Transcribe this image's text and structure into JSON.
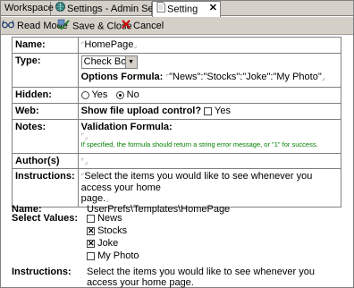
{
  "tabs": [
    {
      "label": "Workspace",
      "icon": "none"
    },
    {
      "label": "Settings - Admin Settings",
      "icon": "globe-icon"
    },
    {
      "label": "Setting",
      "icon": "document-icon"
    }
  ],
  "toolbar": {
    "read_mode": "Read Mode",
    "save_close": "Save & Close",
    "cancel": "Cancel"
  },
  "form": {
    "name_label": "Name:",
    "name_value": "HomePage",
    "type_label": "Type:",
    "type_value": "Check Box",
    "options_formula_label": "Options Formula:",
    "options_formula_value": "\"News\":\"Stocks\":\"Joke\":\"My Photo\"",
    "hidden_label": "Hidden:",
    "hidden_yes": "Yes",
    "hidden_no": "No",
    "web_label": "Web:",
    "web_question": "Show file upload control?",
    "web_yes": "Yes",
    "notes_label": "Notes:",
    "validation_label": "Validation Formula:",
    "validation_hint": "If specified, the formula should return a string error message, or \"1\" for success.",
    "authors_label": "Author(s)",
    "instructions_label": "Instructions:",
    "instructions_line1": "Select the items you would like to see whenever you access your home",
    "instructions_line2": "page."
  },
  "preview": {
    "name_label": "Name:",
    "name_value": "UserPrefs\\Templates\\HomePage",
    "select_label": "Select Values:",
    "options": [
      {
        "label": "News",
        "checked": false
      },
      {
        "label": "Stocks",
        "checked": true
      },
      {
        "label": "Joke",
        "checked": true
      },
      {
        "label": "My Photo",
        "checked": false
      }
    ],
    "instructions_label": "Instructions:",
    "instructions_line1": "Select the items you would like to see whenever you access your home",
    "instructions_line2": "page."
  },
  "colors": {
    "chrome": "#d4d0c8",
    "hint_green": "#008000",
    "cancel_red": "#cc0000"
  }
}
